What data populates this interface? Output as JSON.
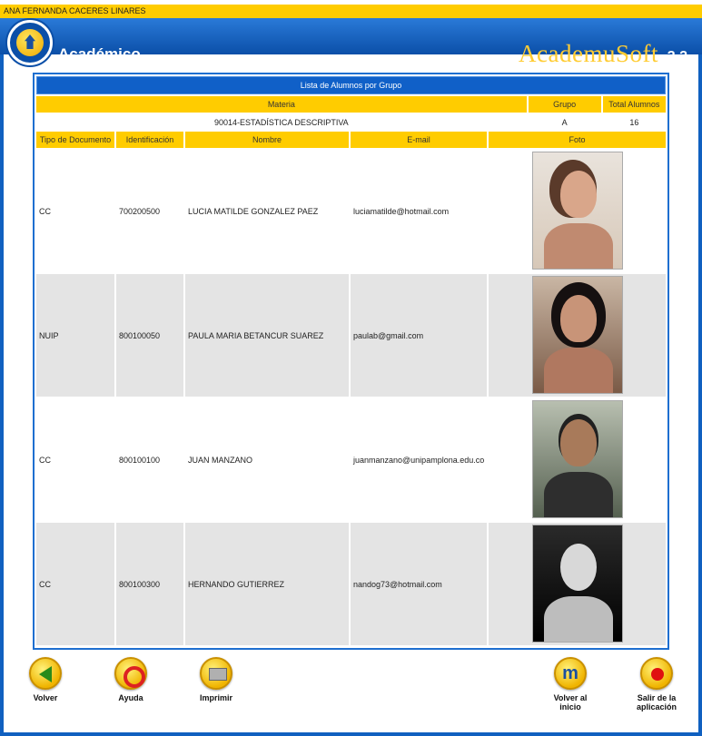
{
  "user": {
    "name": "ANA FERNANDA CACERES LINARES"
  },
  "header": {
    "module_title": "Académico",
    "brand": "AcademuSoft",
    "version": "3.2"
  },
  "list": {
    "caption": "Lista de Alumnos por Grupo",
    "summary_headers": {
      "materia": "Materia",
      "grupo": "Grupo",
      "total": "Total Alumnos"
    },
    "summary_values": {
      "materia": "90014-ESTADÍSTICA DESCRIPTIVA",
      "grupo": "A",
      "total": "16"
    },
    "columns": [
      "Tipo de Documento",
      "Identificación",
      "Nombre",
      "E-mail",
      "Foto"
    ],
    "students": [
      {
        "tipo": "CC",
        "id": "700200500",
        "nombre": "LUCIA MATILDE GONZALEZ PAEZ",
        "email": "luciamatilde@hotmail.com"
      },
      {
        "tipo": "NUIP",
        "id": "800100050",
        "nombre": "PAULA MARIA BETANCUR SUAREZ",
        "email": "paulab@gmail.com"
      },
      {
        "tipo": "CC",
        "id": "800100100",
        "nombre": "JUAN MANZANO",
        "email": "juanmanzano@unipamplona.edu.co"
      },
      {
        "tipo": "CC",
        "id": "800100300",
        "nombre": "HERNANDO GUTIERREZ",
        "email": "nandog73@hotmail.com"
      }
    ]
  },
  "toolbar": {
    "back": "Volver",
    "help": "Ayuda",
    "print": "Imprimir",
    "home": "Volver al inicio",
    "exit": "Salir de la aplicación"
  },
  "colors": {
    "header_blue": "#0b4fa8",
    "accent_yellow": "#ffcc00",
    "row_gray": "#e4e4e4"
  }
}
